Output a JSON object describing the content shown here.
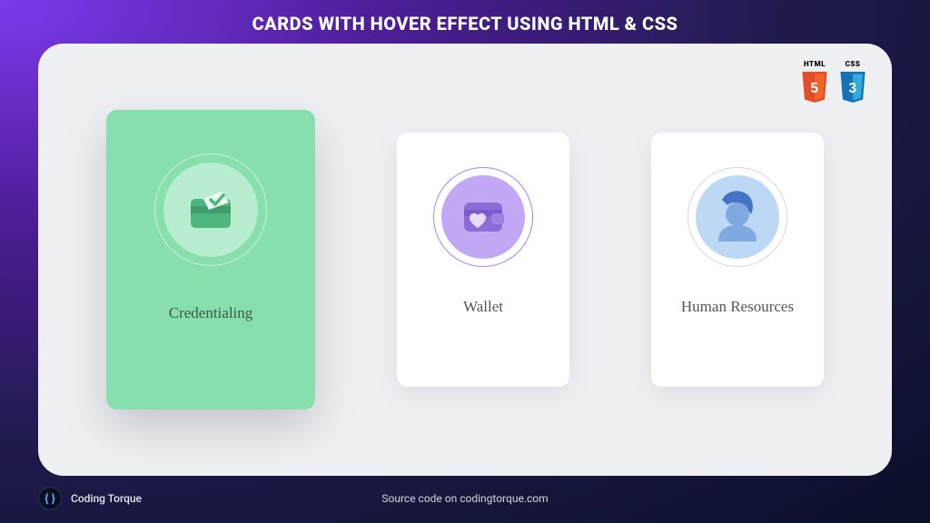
{
  "header": {
    "title": "CARDS WITH HOVER EFFECT USING HTML & CSS"
  },
  "tech": {
    "html_label": "HTML",
    "css_label": "CSS",
    "html_version": "5",
    "css_version": "3",
    "html_color": "#e44d26",
    "css_color": "#1572b6"
  },
  "cards": [
    {
      "title": "Credentialing",
      "icon": "credential-check-icon",
      "state": "hovered",
      "disc_color": "#b9edcf"
    },
    {
      "title": "Wallet",
      "icon": "wallet-heart-icon",
      "state": "normal",
      "disc_color": "#c3a8f5"
    },
    {
      "title": "Human Resources",
      "icon": "person-avatar-icon",
      "state": "normal",
      "disc_color": "#bcd8f5"
    }
  ],
  "footer": {
    "brand_name": "Coding Torque",
    "brand_glyph": "{ }",
    "source_text": "Source code on codingtorque.com"
  }
}
